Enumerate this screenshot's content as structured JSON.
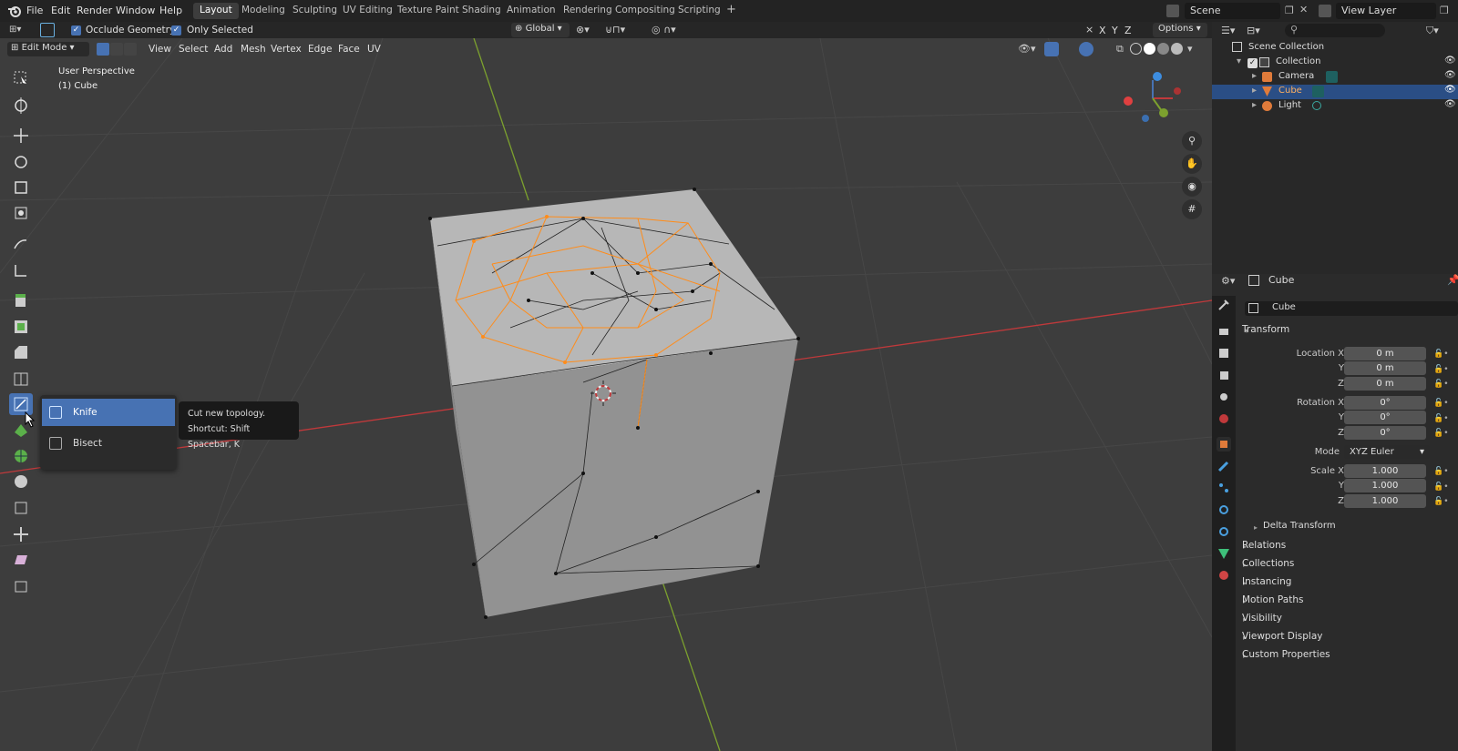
{
  "menu": {
    "file": "File",
    "edit": "Edit",
    "render": "Render",
    "window": "Window",
    "help": "Help"
  },
  "workspaces": [
    "Layout",
    "Modeling",
    "Sculpting",
    "UV Editing",
    "Texture Paint",
    "Shading",
    "Animation",
    "Rendering",
    "Compositing",
    "Scripting"
  ],
  "scene": {
    "label": "Scene",
    "view_layer": "View Layer"
  },
  "header": {
    "occlude_label": "Occlude Geometry",
    "only_selected_label": "Only Selected",
    "transform_orientation": "Global",
    "options_label": "Options",
    "mode": "Edit Mode",
    "view": "View",
    "select": "Select",
    "add": "Add",
    "mesh": "Mesh",
    "vertex": "Vertex",
    "edge": "Edge",
    "face": "Face",
    "uv": "UV",
    "axes": {
      "x": "X",
      "y": "Y",
      "z": "Z"
    }
  },
  "viewport": {
    "perspective": "User Perspective",
    "object": "(1) Cube"
  },
  "flyout": {
    "knife": "Knife",
    "bisect": "Bisect"
  },
  "tooltip": {
    "line1": "Cut new topology.",
    "line2": "Shortcut: Shift Spacebar, K"
  },
  "outliner": {
    "scene_collection": "Scene Collection",
    "collection": "Collection",
    "items": [
      {
        "label": "Camera"
      },
      {
        "label": "Cube"
      },
      {
        "label": "Light"
      }
    ]
  },
  "properties": {
    "object_name": "Cube",
    "data_name": "Cube",
    "transform_title": "Transform",
    "location": {
      "x_label": "Location X",
      "y_label": "Y",
      "z_label": "Z",
      "x": "0 m",
      "y": "0 m",
      "z": "0 m"
    },
    "rotation": {
      "x_label": "Rotation X",
      "y_label": "Y",
      "z_label": "Z",
      "x": "0°",
      "y": "0°",
      "z": "0°"
    },
    "mode": {
      "label": "Mode",
      "value": "XYZ Euler"
    },
    "scale": {
      "x_label": "Scale X",
      "y_label": "Y",
      "z_label": "Z",
      "x": "1.000",
      "y": "1.000",
      "z": "1.000"
    },
    "delta": "Delta Transform",
    "sections": [
      "Relations",
      "Collections",
      "Instancing",
      "Motion Paths",
      "Visibility",
      "Viewport Display",
      "Custom Properties"
    ]
  },
  "colors": {
    "accent": "#4772b3",
    "selected_edge": "#ff8c1a",
    "x_axis": "#c0393b",
    "y_axis": "#7ca12e"
  }
}
